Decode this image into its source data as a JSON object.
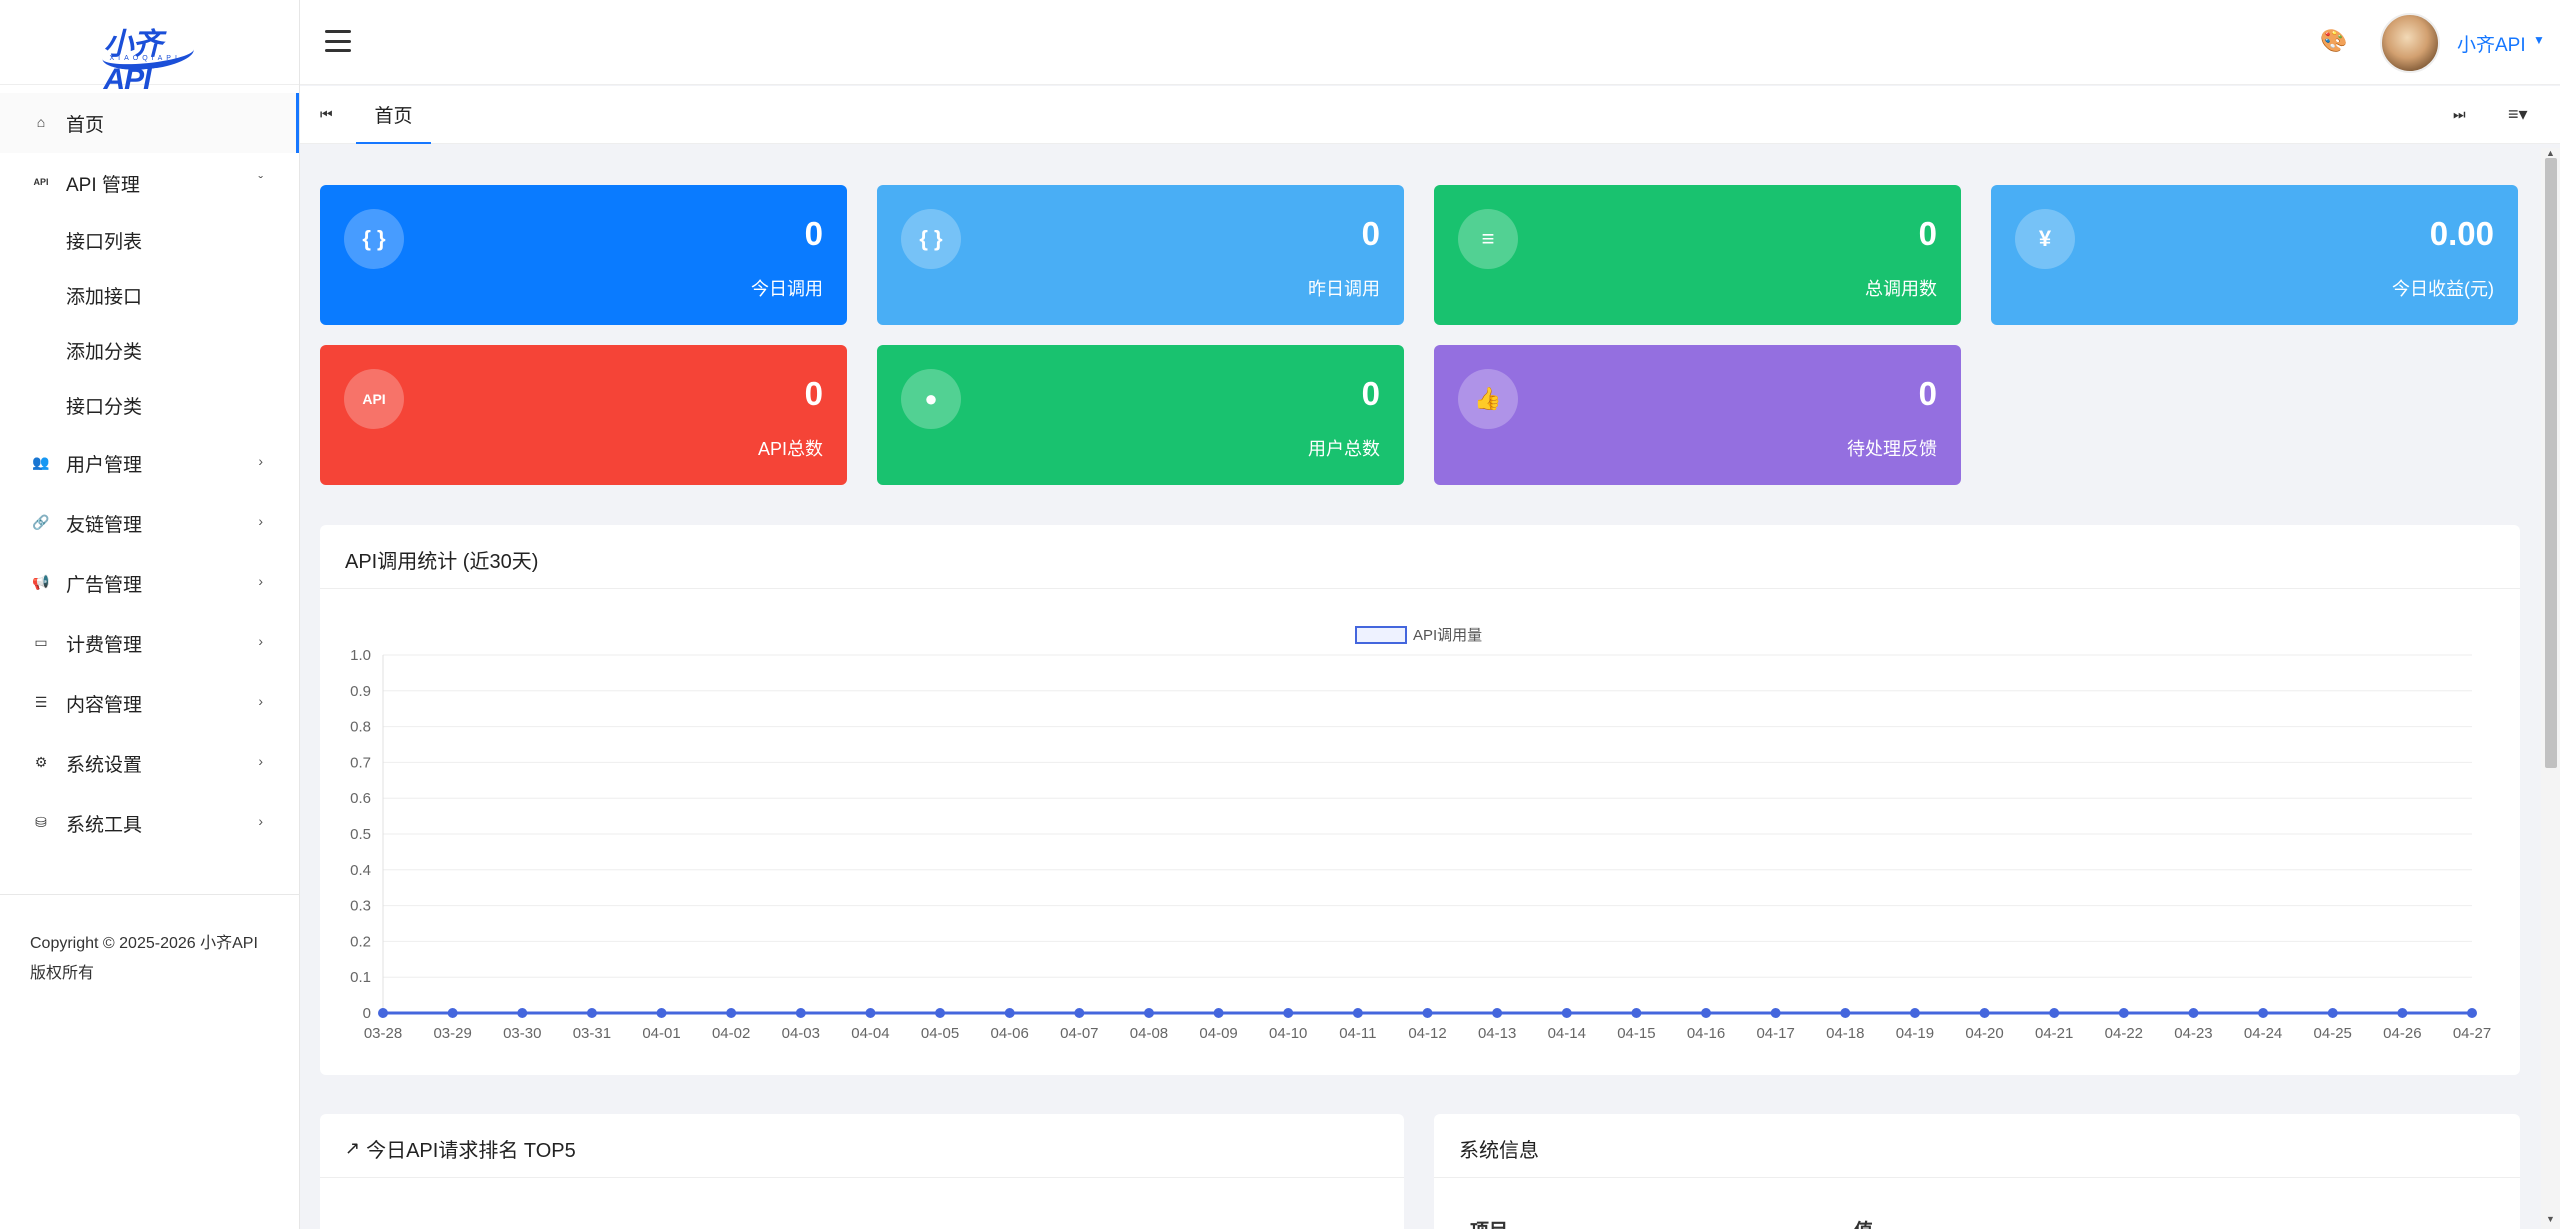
{
  "logo": {
    "text": "小齐API",
    "sub": "XIAOQIAPI"
  },
  "sidebar": {
    "items": [
      {
        "label": "首页",
        "icon": "home-icon"
      },
      {
        "label": "API 管理",
        "icon": "api-icon",
        "expanded": true,
        "children": [
          "接口列表",
          "添加接口",
          "添加分类",
          "接口分类"
        ]
      },
      {
        "label": "用户管理",
        "icon": "users-icon"
      },
      {
        "label": "友链管理",
        "icon": "link-icon"
      },
      {
        "label": "广告管理",
        "icon": "megaphone-icon"
      },
      {
        "label": "计费管理",
        "icon": "credit-card-icon"
      },
      {
        "label": "内容管理",
        "icon": "document-icon"
      },
      {
        "label": "系统设置",
        "icon": "gear-icon"
      },
      {
        "label": "系统工具",
        "icon": "toolbox-icon"
      }
    ],
    "footer": "Copyright © 2025-2026 小齐API 版权所有"
  },
  "header": {
    "user_name": "小齐API"
  },
  "tabs": {
    "home": "首页"
  },
  "stats": [
    {
      "value": "0",
      "label": "今日调用",
      "color": "#0a7bff",
      "icon": "{ }"
    },
    {
      "value": "0",
      "label": "昨日调用",
      "color": "#49aef5",
      "icon": "{ }"
    },
    {
      "value": "0",
      "label": "总调用数",
      "color": "#19c26f",
      "icon": "≡"
    },
    {
      "value": "0.00",
      "label": "今日收益(元)",
      "color": "#49aef5",
      "icon": "¥"
    },
    {
      "value": "0",
      "label": "API总数",
      "color": "#f54437",
      "icon": "API"
    },
    {
      "value": "0",
      "label": "用户总数",
      "color": "#19c26f",
      "icon": "●"
    },
    {
      "value": "0",
      "label": "待处理反馈",
      "color": "#946fe0",
      "icon": "👍"
    }
  ],
  "chart_panel": {
    "title": "API调用统计 (近30天)"
  },
  "chart_data": {
    "type": "line",
    "categories": [
      "03-28",
      "03-29",
      "03-30",
      "03-31",
      "04-01",
      "04-02",
      "04-03",
      "04-04",
      "04-05",
      "04-06",
      "04-07",
      "04-08",
      "04-09",
      "04-10",
      "04-11",
      "04-12",
      "04-13",
      "04-14",
      "04-15",
      "04-16",
      "04-17",
      "04-18",
      "04-19",
      "04-20",
      "04-21",
      "04-22",
      "04-23",
      "04-24",
      "04-25",
      "04-26",
      "04-27"
    ],
    "series": [
      {
        "name": "API调用量",
        "values": [
          0,
          0,
          0,
          0,
          0,
          0,
          0,
          0,
          0,
          0,
          0,
          0,
          0,
          0,
          0,
          0,
          0,
          0,
          0,
          0,
          0,
          0,
          0,
          0,
          0,
          0,
          0,
          0,
          0,
          0,
          0
        ]
      }
    ],
    "yticks": [
      "0",
      "0.1",
      "0.2",
      "0.3",
      "0.4",
      "0.5",
      "0.6",
      "0.7",
      "0.8",
      "0.9",
      "1.0"
    ],
    "ylim": [
      0,
      1.0
    ],
    "grid": true,
    "legend": "top-center",
    "line_color": "#4466dd"
  },
  "rank_panel": {
    "title": "今日API请求排名 TOP5",
    "icon": "trend-icon"
  },
  "sys_panel": {
    "title": "系统信息",
    "col1": "项目",
    "col2": "值"
  }
}
